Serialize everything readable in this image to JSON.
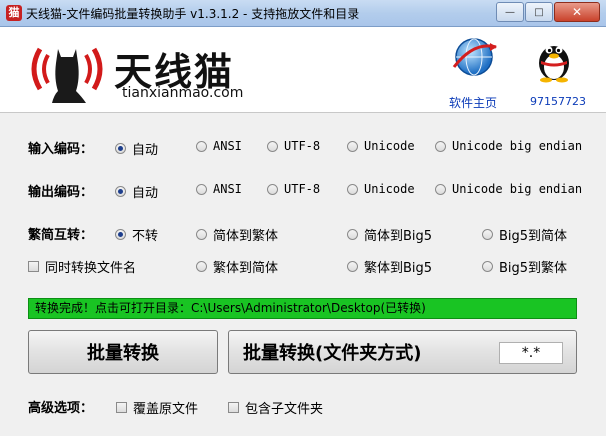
{
  "window": {
    "title": "天线猫-文件编码批量转换助手 v1.3.1.2 - 支持拖放文件和目录",
    "buttons": {
      "minimize": "—",
      "maximize": "□",
      "close": "✕"
    }
  },
  "header": {
    "logo_text": "天线猫",
    "logo_url": "tianxianmao.com",
    "home_label": "软件主页",
    "qq_label": "97157723"
  },
  "input_encoding": {
    "label": "输入编码：",
    "options": [
      "自动",
      "ANSI",
      "UTF-8",
      "Unicode",
      "Unicode big endian"
    ],
    "selected": 0
  },
  "output_encoding": {
    "label": "输出编码：",
    "options": [
      "自动",
      "ANSI",
      "UTF-8",
      "Unicode",
      "Unicode big endian"
    ],
    "selected": 0
  },
  "convert": {
    "label": "繁简互转：",
    "options": [
      "不转",
      "简体到繁体",
      "简体到Big5",
      "Big5到简体",
      "繁体到简体",
      "繁体到Big5",
      "Big5到繁体"
    ],
    "selected": 0,
    "rename_checkbox": "同时转换文件名",
    "rename_checked": false
  },
  "status": {
    "text": "转换完成！点击可打开目录：C:\\Users\\Administrator\\Desktop(已转换)",
    "color": "#19c423"
  },
  "actions": {
    "batch_convert": "批量转换",
    "batch_convert_folder": "批量转换(文件夹方式)",
    "extension_filter": "*.*"
  },
  "advanced": {
    "label": "高级选项：",
    "overwrite": "覆盖原文件",
    "overwrite_checked": false,
    "include_subfolders": "包含子文件夹",
    "include_subfolders_checked": false
  }
}
